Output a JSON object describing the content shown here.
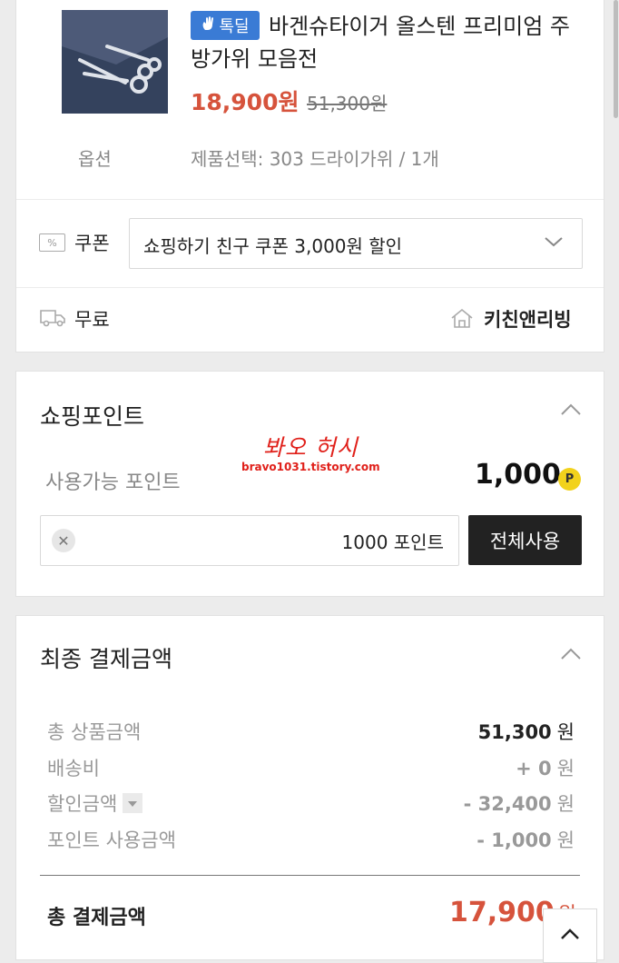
{
  "product": {
    "badge_text": "톡딜",
    "title": "바겐슈타이거 올스텐 프리미엄 주방가위 모음전",
    "price": "18,900원",
    "original_price": "51,300원",
    "option_label": "옵션",
    "option_value": "제품선택: 303 드라이가위 / 1개"
  },
  "coupon": {
    "label": "쿠폰",
    "selected": "쇼핑하기 친구 쿠폰 3,000원 할인"
  },
  "shipping": {
    "label": "무료",
    "seller": "키친앤리빙"
  },
  "points": {
    "title": "쇼핑포인트",
    "available_label": "사용가능 포인트",
    "available_value": "1,000",
    "point_icon_text": "P",
    "input_value": "1000 포인트",
    "use_all_button": "전체사용",
    "watermark_line1": "봐오 허시",
    "watermark_line2": "bravo1031.tistory.com"
  },
  "payment": {
    "title": "최종 결제금액",
    "rows": [
      {
        "label": "총 상품금액",
        "value": "51,300",
        "unit": "원"
      },
      {
        "label": "배송비",
        "value": "+ 0",
        "unit": "원"
      },
      {
        "label": "할인금액",
        "value": "- 32,400",
        "unit": "원"
      },
      {
        "label": "포인트 사용금액",
        "value": "- 1,000",
        "unit": "원"
      }
    ],
    "total_label": "총 결제금액",
    "total_value": "17,900",
    "total_unit": "원"
  },
  "colors": {
    "accent_price": "#d6533c",
    "badge_blue": "#3a7bd5",
    "point_yellow": "#f2d21c",
    "button_dark": "#222222"
  },
  "icons": [
    "hand-icon",
    "coupon-icon",
    "chevron-down-icon",
    "truck-icon",
    "home-icon",
    "chevron-up-icon",
    "clear-icon",
    "point-icon",
    "dropdown-icon"
  ]
}
